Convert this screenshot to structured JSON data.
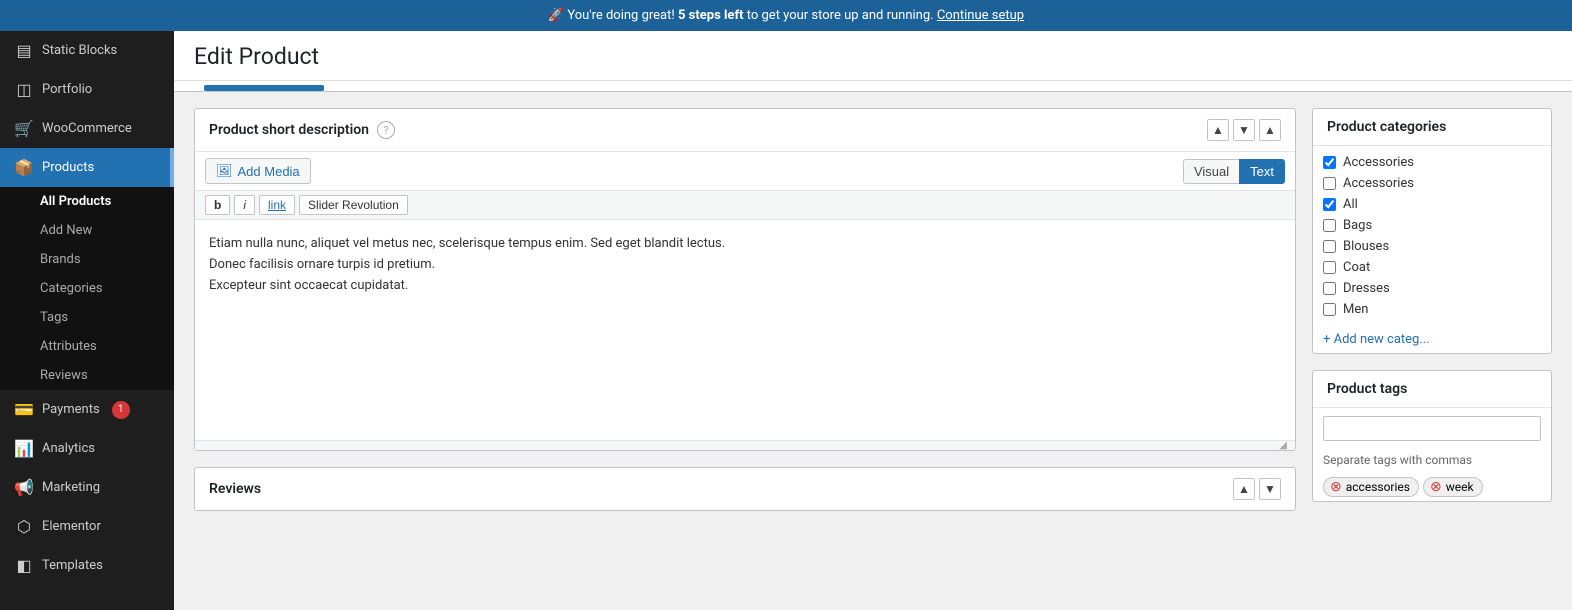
{
  "banner": {
    "text_prefix": "🚀 You're doing great!",
    "bold_text": "5 steps left",
    "text_suffix": "to get your store up and running.",
    "link_text": "Continue setup"
  },
  "sidebar": {
    "items": [
      {
        "id": "static-blocks",
        "label": "Static Blocks",
        "icon": "▤",
        "active": false
      },
      {
        "id": "portfolio",
        "label": "Portfolio",
        "icon": "◫",
        "active": false
      },
      {
        "id": "woocommerce",
        "label": "WooCommerce",
        "icon": "🛒",
        "active": false
      },
      {
        "id": "products",
        "label": "Products",
        "icon": "▤",
        "active": true
      },
      {
        "id": "all-products-sub",
        "label": "All Products",
        "active": true,
        "submenu": true
      },
      {
        "id": "add-new-sub",
        "label": "Add New",
        "submenu": true
      },
      {
        "id": "brands-sub",
        "label": "Brands",
        "submenu": true
      },
      {
        "id": "categories-sub",
        "label": "Categories",
        "submenu": true
      },
      {
        "id": "tags-sub",
        "label": "Tags",
        "submenu": true
      },
      {
        "id": "attributes-sub",
        "label": "Attributes",
        "submenu": true
      },
      {
        "id": "reviews-sub",
        "label": "Reviews",
        "submenu": true
      },
      {
        "id": "payments",
        "label": "Payments",
        "icon": "💳",
        "badge": "1",
        "active": false
      },
      {
        "id": "analytics",
        "label": "Analytics",
        "icon": "📊",
        "active": false
      },
      {
        "id": "marketing",
        "label": "Marketing",
        "icon": "📢",
        "active": false
      },
      {
        "id": "elementor",
        "label": "Elementor",
        "icon": "⬡",
        "active": false
      },
      {
        "id": "templates",
        "label": "Templates",
        "icon": "◧",
        "active": false
      }
    ]
  },
  "page": {
    "title": "Edit Product"
  },
  "short_description": {
    "section_title": "Product short description",
    "help_tooltip": "?",
    "add_media_label": "Add Media",
    "visual_tab": "Visual",
    "text_tab": "Text",
    "format_buttons": [
      "b",
      "i",
      "link",
      "Slider Revolution"
    ],
    "content_lines": [
      "Etiam nulla nunc, aliquet vel metus nec, scelerisque tempus enim. Sed eget blandit lectus.",
      "Donec facilisis ornare turpis id pretium.",
      "Excepteur sint occaecat cupidatat."
    ]
  },
  "product_categories": {
    "title": "Product categories",
    "items": [
      {
        "label": "Accessories",
        "checked": true
      },
      {
        "label": "Accessories",
        "checked": false
      },
      {
        "label": "All",
        "checked": true
      },
      {
        "label": "Bags",
        "checked": false
      },
      {
        "label": "Blouses",
        "checked": false
      },
      {
        "label": "Coat",
        "checked": false
      },
      {
        "label": "Dresses",
        "checked": false
      },
      {
        "label": "Men",
        "checked": false
      }
    ],
    "add_new_label": "+ Add new categ..."
  },
  "product_tags": {
    "title": "Product tags",
    "input_placeholder": "",
    "hint": "Separate tags with commas",
    "tags": [
      "accessories",
      "week"
    ]
  },
  "reviews": {
    "title": "Reviews"
  }
}
